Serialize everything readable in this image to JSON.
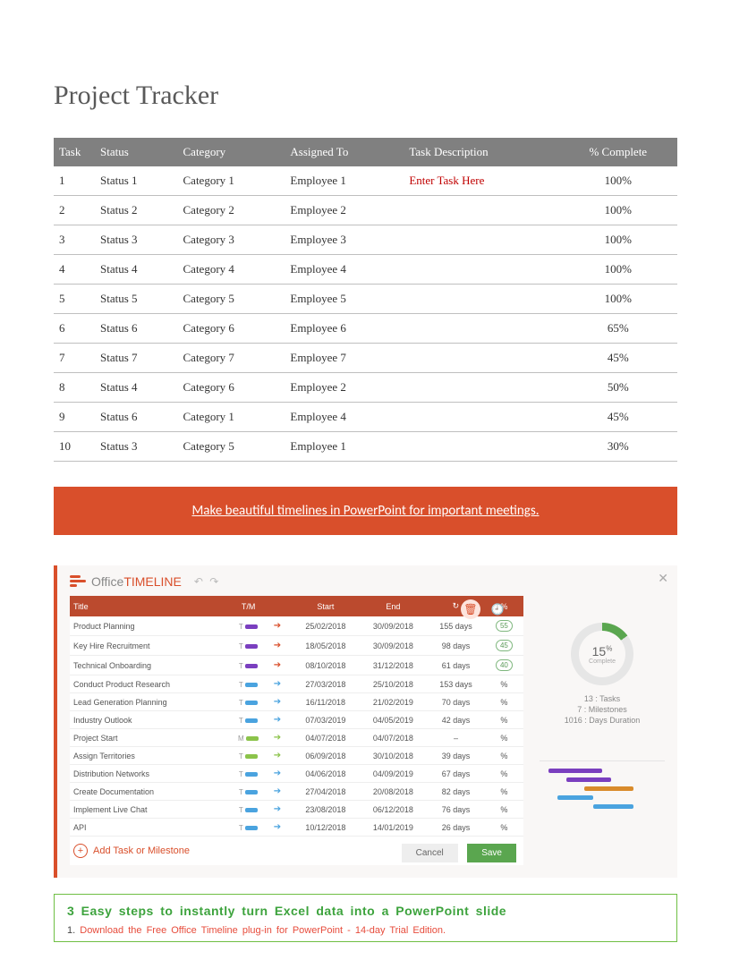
{
  "title": "Project Tracker",
  "table": {
    "headers": [
      "Task",
      "Status",
      "Category",
      "Assigned To",
      "Task Description",
      "% Complete"
    ],
    "rows": [
      {
        "task": "1",
        "status": "Status 1",
        "category": "Category 1",
        "assigned": "Employee 1",
        "desc": "Enter Task Here",
        "pct": "100%"
      },
      {
        "task": "2",
        "status": "Status 2",
        "category": "Category 2",
        "assigned": "Employee 2",
        "desc": "",
        "pct": "100%"
      },
      {
        "task": "3",
        "status": "Status 3",
        "category": "Category 3",
        "assigned": "Employee 3",
        "desc": "",
        "pct": "100%"
      },
      {
        "task": "4",
        "status": "Status 4",
        "category": "Category 4",
        "assigned": "Employee 4",
        "desc": "",
        "pct": "100%"
      },
      {
        "task": "5",
        "status": "Status 5",
        "category": "Category 5",
        "assigned": "Employee 5",
        "desc": "",
        "pct": "100%"
      },
      {
        "task": "6",
        "status": "Status 6",
        "category": "Category 6",
        "assigned": "Employee 6",
        "desc": "",
        "pct": "65%"
      },
      {
        "task": "7",
        "status": "Status 7",
        "category": "Category 7",
        "assigned": "Employee 7",
        "desc": "",
        "pct": "45%"
      },
      {
        "task": "8",
        "status": "Status 4",
        "category": "Category 6",
        "assigned": "Employee 2",
        "desc": "",
        "pct": "50%"
      },
      {
        "task": "9",
        "status": "Status 6",
        "category": "Category 1",
        "assigned": "Employee 4",
        "desc": "",
        "pct": "45%"
      },
      {
        "task": "10",
        "status": "Status 3",
        "category": "Category 5",
        "assigned": "Employee 1",
        "desc": "",
        "pct": "30%"
      }
    ]
  },
  "banner": "Make beautiful timelines in PowerPoint for important meetings.",
  "ot": {
    "brand_a": "Office",
    "brand_b": "TIMELINE",
    "undo": "↶  ↷",
    "close": "✕",
    "delete": "🗑",
    "clock": "🕘",
    "headers": {
      "title": "Title",
      "tm": "T/M",
      "start": "Start",
      "end": "End",
      "dur": "↻",
      "pct": "%"
    },
    "rows": [
      {
        "title": "Product Planning",
        "tm": "T",
        "color": "#7a3fbf",
        "arrow": "#d94f2b",
        "start": "25/02/2018",
        "end": "30/09/2018",
        "dur": "155 days",
        "pct": "55",
        "pill": true
      },
      {
        "title": "Key Hire Recruitment",
        "tm": "T",
        "color": "#7a3fbf",
        "arrow": "#d94f2b",
        "start": "18/05/2018",
        "end": "30/09/2018",
        "dur": "98 days",
        "pct": "45",
        "pill": true
      },
      {
        "title": "Technical Onboarding",
        "tm": "T",
        "color": "#7a3fbf",
        "arrow": "#d94f2b",
        "start": "08/10/2018",
        "end": "31/12/2018",
        "dur": "61 days",
        "pct": "40",
        "pill": true
      },
      {
        "title": "Conduct Product Research",
        "tm": "T",
        "color": "#4aa3df",
        "arrow": "#4aa3df",
        "start": "27/03/2018",
        "end": "25/10/2018",
        "dur": "153 days",
        "pct": "%",
        "pill": false
      },
      {
        "title": "Lead Generation Planning",
        "tm": "T",
        "color": "#4aa3df",
        "arrow": "#4aa3df",
        "start": "16/11/2018",
        "end": "21/02/2019",
        "dur": "70 days",
        "pct": "%",
        "pill": false
      },
      {
        "title": "Industry Outlook",
        "tm": "T",
        "color": "#4aa3df",
        "arrow": "#4aa3df",
        "start": "07/03/2019",
        "end": "04/05/2019",
        "dur": "42 days",
        "pct": "%",
        "pill": false
      },
      {
        "title": "Project Start",
        "tm": "M",
        "color": "#8bc34a",
        "arrow": "#8bc34a",
        "start": "04/07/2018",
        "end": "04/07/2018",
        "dur": "–",
        "pct": "%",
        "pill": false
      },
      {
        "title": "Assign Territories",
        "tm": "T",
        "color": "#8bc34a",
        "arrow": "#8bc34a",
        "start": "06/09/2018",
        "end": "30/10/2018",
        "dur": "39 days",
        "pct": "%",
        "pill": false
      },
      {
        "title": "Distribution Networks",
        "tm": "T",
        "color": "#4aa3df",
        "arrow": "#4aa3df",
        "start": "04/06/2018",
        "end": "04/09/2019",
        "dur": "67 days",
        "pct": "%",
        "pill": false
      },
      {
        "title": "Create Documentation",
        "tm": "T",
        "color": "#4aa3df",
        "arrow": "#4aa3df",
        "start": "27/04/2018",
        "end": "20/08/2018",
        "dur": "82 days",
        "pct": "%",
        "pill": false
      },
      {
        "title": "Implement Live Chat",
        "tm": "T",
        "color": "#4aa3df",
        "arrow": "#4aa3df",
        "start": "23/08/2018",
        "end": "06/12/2018",
        "dur": "76 days",
        "pct": "%",
        "pill": false
      },
      {
        "title": "API",
        "tm": "T",
        "color": "#4aa3df",
        "arrow": "#4aa3df",
        "start": "10/12/2018",
        "end": "14/01/2019",
        "dur": "26 days",
        "pct": "%",
        "pill": false
      }
    ],
    "add": "Add Task or Milestone",
    "cancel": "Cancel",
    "save": "Save",
    "donut_pct": "15",
    "donut_sub": "Complete",
    "stats": [
      "13 : Tasks",
      "7 : Milestones",
      "1016 : Days Duration"
    ]
  },
  "steps": {
    "title": "3 Easy steps to instantly turn Excel data into a PowerPoint slide",
    "line_num": "1.",
    "line_text": "Download the Free Office Timeline plug-in for PowerPoint - 14-day Trial Edition."
  },
  "chart_data": {
    "type": "table",
    "title": "Project Tracker",
    "columns": [
      "Task",
      "Status",
      "Category",
      "Assigned To",
      "Task Description",
      "% Complete"
    ],
    "rows": [
      [
        1,
        "Status 1",
        "Category 1",
        "Employee 1",
        "Enter Task Here",
        100
      ],
      [
        2,
        "Status 2",
        "Category 2",
        "Employee 2",
        "",
        100
      ],
      [
        3,
        "Status 3",
        "Category 3",
        "Employee 3",
        "",
        100
      ],
      [
        4,
        "Status 4",
        "Category 4",
        "Employee 4",
        "",
        100
      ],
      [
        5,
        "Status 5",
        "Category 5",
        "Employee 5",
        "",
        100
      ],
      [
        6,
        "Status 6",
        "Category 6",
        "Employee 6",
        "",
        65
      ],
      [
        7,
        "Status 7",
        "Category 7",
        "Employee 7",
        "",
        45
      ],
      [
        8,
        "Status 4",
        "Category 6",
        "Employee 2",
        "",
        50
      ],
      [
        9,
        "Status 6",
        "Category 1",
        "Employee 4",
        "",
        45
      ],
      [
        10,
        "Status 3",
        "Category 5",
        "Employee 1",
        "",
        30
      ]
    ]
  }
}
